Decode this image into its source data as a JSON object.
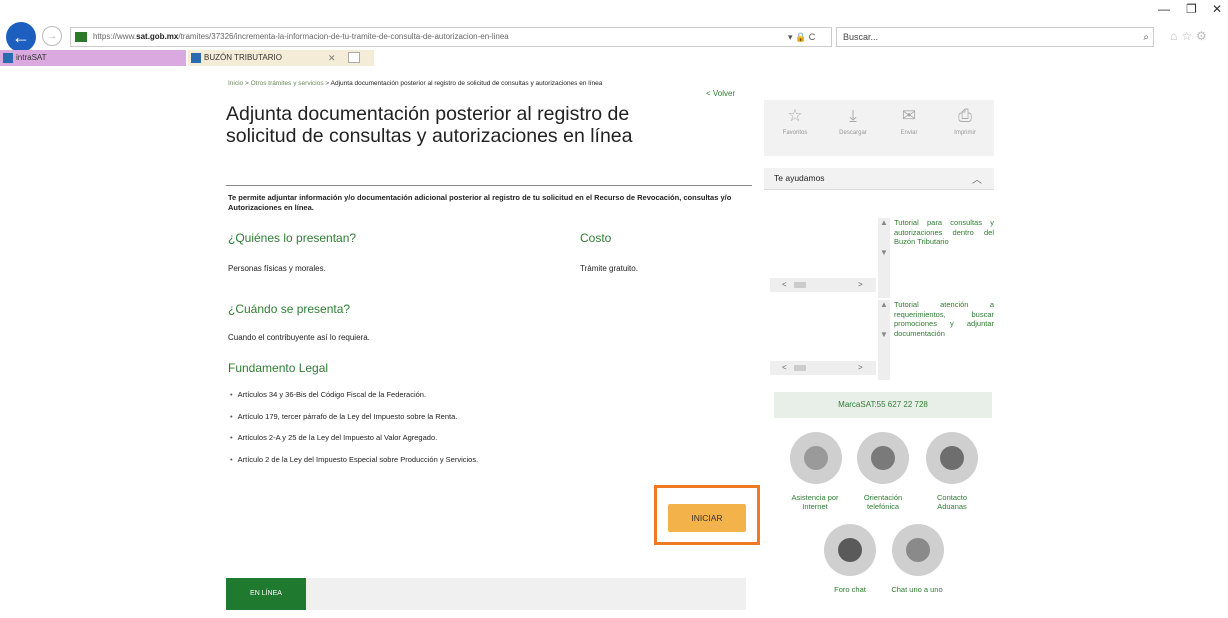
{
  "browser": {
    "url_prefix": "https://www.",
    "url_domain": "sat.gob.mx",
    "url_rest": "/tramites/37326/incrementa-la-informacion-de-tu-tramite-de-consulta-de-autorizacion-en-linea",
    "address_icons": "▾ 🔒 C",
    "search_placeholder": "Buscar...",
    "search_icon": "⌕",
    "toolbar_icons": "⌂☆⚙",
    "minimize": "—",
    "maximize": "❐",
    "close": "✕",
    "back_glyph": "←",
    "forward_glyph": "→"
  },
  "tabs": [
    {
      "label": "intraSAT"
    },
    {
      "label": "BUZÓN TRIBUTARIO",
      "close": "✕"
    }
  ],
  "breadcrumb": {
    "items": [
      "Inicio",
      "Otros trámites y servicios"
    ],
    "separator": " > ",
    "current": "Adjunta documentación posterior al registro de solicitud de consultas y autorizaciones en línea"
  },
  "volver": "< Volver",
  "main": {
    "title": "Adjunta documentación posterior al registro de solicitud de consultas y autorizaciones en línea",
    "description": "Te permite adjuntar información y/o documentación adicional posterior al registro de tu solicitud en el Recurso de Revocación, consultas y/o Autorizaciones en línea.",
    "quienes_heading": "¿Quiénes lo presentan?",
    "quienes_text": "Personas físicas y morales.",
    "costo_heading": "Costo",
    "costo_text": "Trámite gratuito.",
    "cuando_heading": "¿Cuándo se presenta?",
    "cuando_text": "Cuando el contribuyente así lo requiera.",
    "fundamento_heading": "Fundamento Legal",
    "laws": [
      "Artículos 34 y 36-Bis del Código Fiscal de la Federación.",
      "Artículo 179, tercer párrafo de la Ley del Impuesto sobre la Renta.",
      "Artículos 2-A y 25 de la Ley del Impuesto al Valor Agregado.",
      "Artículo 2 de la Ley del Impuesto Especial sobre Producción y Servicios."
    ],
    "iniciar": "INICIAR",
    "en_linea": "EN LÍNEA"
  },
  "sidebar": {
    "actions": [
      {
        "label": "Favoritos",
        "icon": "star-icon",
        "glyph": "☆"
      },
      {
        "label": "Descargar",
        "icon": "download-icon",
        "glyph": "⤓"
      },
      {
        "label": "Enviar",
        "icon": "send-icon",
        "glyph": "✉"
      },
      {
        "label": "Imprimir",
        "icon": "print-icon",
        "glyph": "⎙"
      }
    ],
    "help_label": "Te ayudamos",
    "help_chevron": "︿",
    "tutorials": [
      "Tutorial para consultas y autorizaciones dentro del Buzón Tributario",
      "Tutorial atención a requerimientos, buscar promociones y adjuntar documentación"
    ],
    "scroll_left": "<",
    "scroll_right": ">",
    "scroll_up": "▲",
    "scroll_down": "▼",
    "marca_sat": "MarcaSAT:55 627 22 728",
    "contacts": [
      {
        "label": "Asistencia por Internet"
      },
      {
        "label": "Orientación telefónica"
      },
      {
        "label": "Contacto Aduanas"
      },
      {
        "label": "Foro chat"
      },
      {
        "label": "Chat uno a uno"
      }
    ]
  }
}
